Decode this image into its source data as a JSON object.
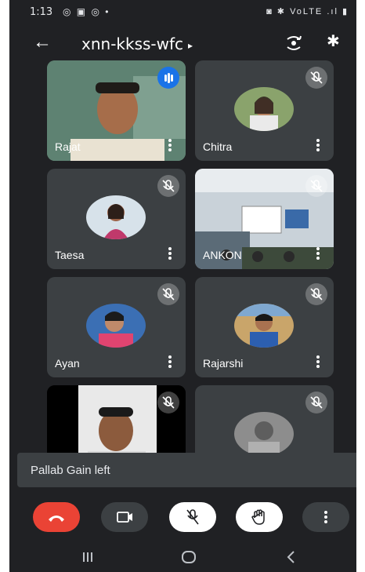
{
  "status_bar": {
    "time": "1:13",
    "left_icons": "◎ ▣ ◎ •",
    "right_icons": "◙ ✱ VoLTE .ıl ▮"
  },
  "header": {
    "meeting_code": "xnn-kkss-wfc",
    "caret": "▸"
  },
  "participants": [
    {
      "name": "Rajat",
      "state": "speaking"
    },
    {
      "name": "Chitra",
      "state": "muted"
    },
    {
      "name": "Taesa",
      "state": "muted"
    },
    {
      "name": "ANKON",
      "state": "muted"
    },
    {
      "name": "Ayan",
      "state": "muted"
    },
    {
      "name": "Rajarshi",
      "state": "muted"
    },
    {
      "name": "",
      "state": "muted"
    },
    {
      "name": "",
      "state": "muted"
    }
  ],
  "toast": {
    "message": "Pallab Gain left"
  },
  "controls": [
    "end-call",
    "camera",
    "mic-off",
    "raise-hand",
    "more-options"
  ],
  "colors": {
    "background": "#202124",
    "tile": "#3c4043",
    "end_call": "#ea4335",
    "active_speaker": "#1a73e8"
  }
}
